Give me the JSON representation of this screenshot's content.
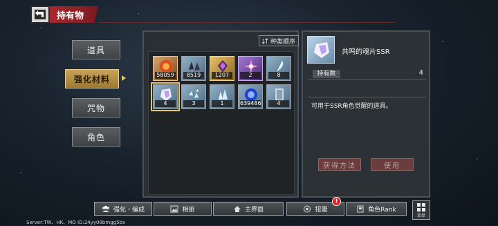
{
  "header": {
    "title": "持有物"
  },
  "tabs": [
    {
      "label": "道具",
      "active": false
    },
    {
      "label": "强化材料",
      "active": true
    },
    {
      "label": "咒物",
      "active": false
    },
    {
      "label": "角色",
      "active": false
    }
  ],
  "inventory": {
    "sort_label": "种类顺序",
    "items": [
      {
        "icon": "orange-orb-icon",
        "count": "58059",
        "selected": false
      },
      {
        "icon": "dark-shards-icon",
        "count": "8519",
        "selected": false
      },
      {
        "icon": "gold-crystal-icon",
        "count": "1207",
        "selected": false
      },
      {
        "icon": "purple-star-crystal-icon",
        "count": "2",
        "selected": false
      },
      {
        "icon": "feather-icon",
        "count": "8",
        "selected": false
      },
      {
        "icon": "soul-shard-ssr-icon",
        "count": "4",
        "selected": true
      },
      {
        "icon": "blue-fragments-icon",
        "count": "3",
        "selected": false
      },
      {
        "icon": "crystal-cluster-icon",
        "count": "1",
        "selected": false
      },
      {
        "icon": "blue-orb-icon",
        "count": "639486",
        "selected": false
      },
      {
        "icon": "stone-tablet-icon",
        "count": "4",
        "selected": false
      }
    ]
  },
  "detail": {
    "name": "共鸣的魂片SSR",
    "have_label": "持有数",
    "have_value": "4",
    "description": "可用于SSR角色觉醒的道具。",
    "obtain_label": "获得方法",
    "use_label": "使用"
  },
  "bottom_nav": [
    {
      "label": "强化・编成",
      "icon": "party-icon"
    },
    {
      "label": "相册",
      "icon": "album-icon"
    },
    {
      "label": "主界面",
      "icon": "home-icon"
    },
    {
      "label": "扭蛋",
      "icon": "gacha-icon"
    },
    {
      "label": "角色Rank",
      "icon": "rank-icon"
    }
  ],
  "gacha_badge": "!",
  "menu_label": "菜单",
  "server_text": "Server:TW、HK、MO ID:24yy08bmgg5bx"
}
